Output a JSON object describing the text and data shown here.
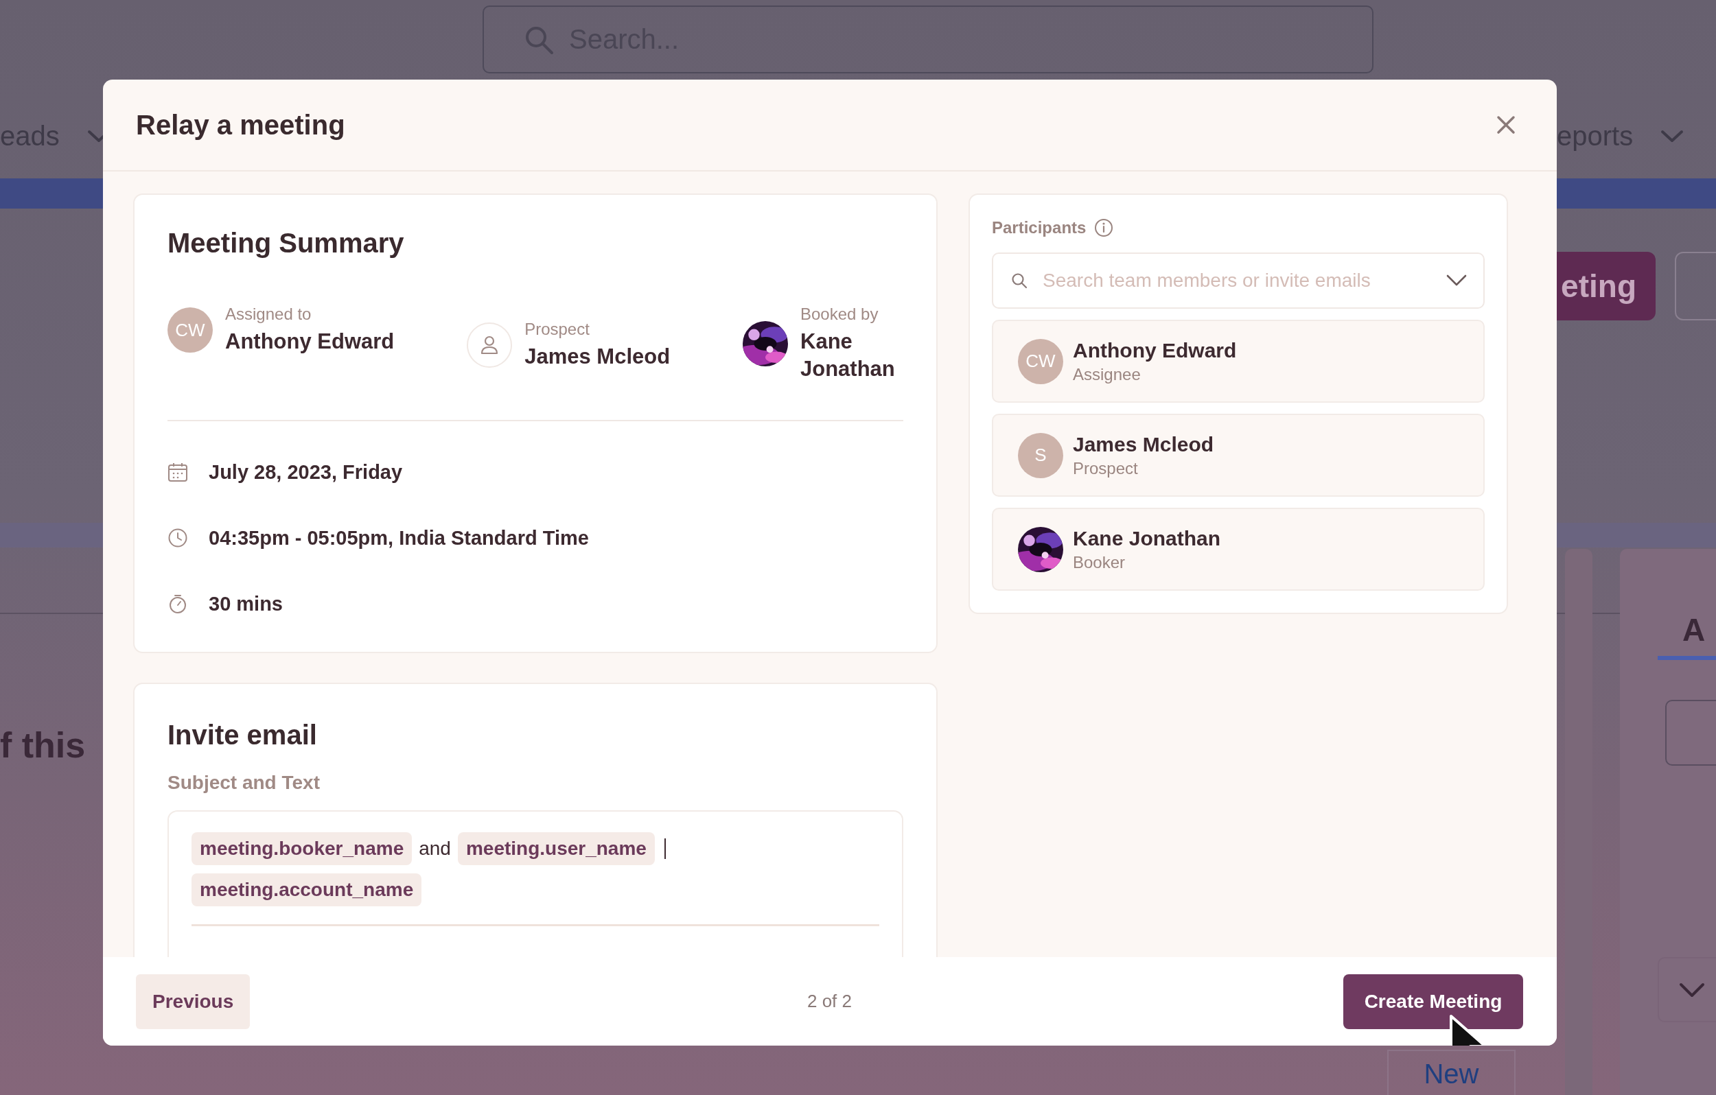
{
  "backdrop": {
    "search": {
      "placeholder": "Search..."
    },
    "nav": [
      {
        "label": "eads"
      },
      {
        "label": "eports"
      }
    ],
    "button": "eting",
    "heading": "f this",
    "tabs": [
      {
        "label": "A",
        "selected": true
      }
    ],
    "new_button": "New"
  },
  "dialog": {
    "title": "Relay a meeting",
    "summary": {
      "title": "Meeting Summary",
      "people": [
        {
          "role": "Assigned to",
          "name": "Anthony Edward",
          "avatar": {
            "kind": "initials",
            "text": "CW"
          }
        },
        {
          "role": "Prospect",
          "name": "James Mcleod",
          "avatar": {
            "kind": "icon"
          }
        },
        {
          "role": "Booked by",
          "name": "Kane Jonathan"
        }
      ],
      "details": [
        {
          "kind": "date",
          "text": "July 28, 2023, Friday"
        },
        {
          "kind": "time",
          "text": "04:35pm - 05:05pm, India Standard Time"
        },
        {
          "kind": "duration",
          "text": "30 mins"
        }
      ]
    },
    "invite": {
      "title": "Invite email",
      "label": "Subject and Text",
      "content": [
        {
          "kind": "token",
          "text": "meeting.booker_name"
        },
        {
          "kind": "text",
          "text": "and"
        },
        {
          "kind": "token",
          "text": "meeting.user_name"
        },
        {
          "kind": "caret"
        },
        {
          "kind": "token",
          "text": "meeting.account_name"
        }
      ]
    },
    "participants": {
      "label": "Participants",
      "search": {
        "placeholder": "Search team members or invite emails"
      },
      "items": [
        {
          "name": "Anthony Edward",
          "role": "Assignee",
          "avatar": {
            "kind": "initials",
            "text": "CW"
          }
        },
        {
          "name": "James Mcleod",
          "role": "Prospect",
          "avatar": {
            "kind": "initials",
            "text": "S"
          }
        },
        {
          "name": "Kane Jonathan",
          "role": "Booker"
        }
      ]
    },
    "footer": {
      "previous": "Previous",
      "page": "2 of 2",
      "create": "Create Meeting"
    }
  }
}
